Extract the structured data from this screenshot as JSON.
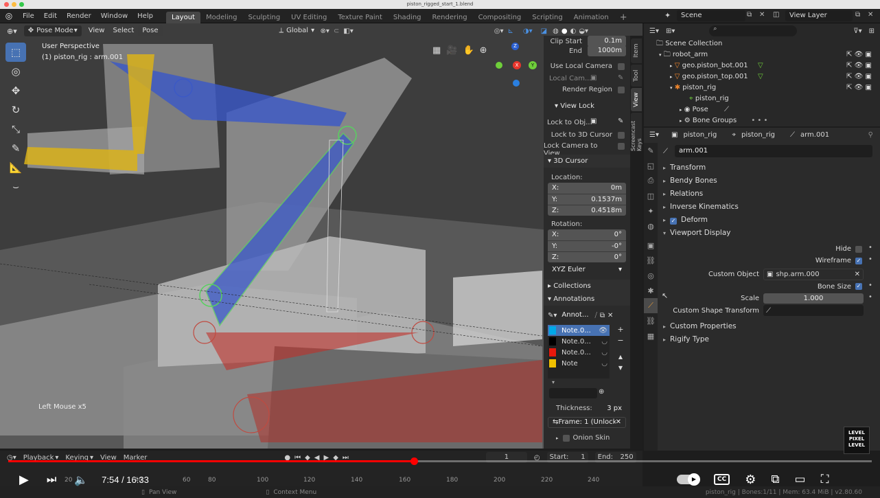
{
  "window": {
    "title": "piston_rigged_start_1.blend"
  },
  "topbar": {
    "menus": [
      "File",
      "Edit",
      "Render",
      "Window",
      "Help"
    ],
    "workspaces": [
      "Layout",
      "Modeling",
      "Sculpting",
      "UV Editing",
      "Texture Paint",
      "Shading",
      "Rendering",
      "Compositing",
      "Scripting",
      "Animation"
    ],
    "active_workspace": "Layout",
    "add_tab": "+",
    "scene": "Scene",
    "view_layer": "View Layer"
  },
  "viewport_header": {
    "mode": "Pose Mode",
    "view": "View",
    "select": "Select",
    "pose": "Pose",
    "orientation": "Global"
  },
  "viewport": {
    "perspective": "User Perspective",
    "object_info": "(1) piston_rig : arm.001",
    "last_op": "Left Mouse x5",
    "gizmo": {
      "z": "Z",
      "x": "X",
      "y": "Y"
    }
  },
  "npanel": {
    "clip_start_label": "Clip Start",
    "clip_start": "0.1m",
    "end_label": "End",
    "end": "1000m",
    "use_local_camera": "Use Local Camera",
    "local_camera": "Local Cam...",
    "render_region": "Render Region",
    "view_lock": "View Lock",
    "lock_to_obj": "Lock to Obj...",
    "lock_3d_cursor": "Lock to 3D Cursor",
    "lock_camera_to_view": "Lock Camera to View",
    "cursor_3d": "3D Cursor",
    "location": "Location:",
    "loc_x": "0m",
    "loc_y": "0.1537m",
    "loc_z": "0.4518m",
    "rotation": "Rotation:",
    "rot_x": "0°",
    "rot_y": "-0°",
    "rot_z": "0°",
    "rotation_mode": "XYZ Euler",
    "collections": "Collections",
    "annotations": "Annotations",
    "annot_name": "Annot...",
    "notes": [
      {
        "name": "Note.0...",
        "color": "#00a8e8"
      },
      {
        "name": "Note.0...",
        "color": "#000000"
      },
      {
        "name": "Note.0...",
        "color": "#e8180c"
      },
      {
        "name": "Note",
        "color": "#f0c000"
      }
    ],
    "thickness_label": "Thickness:",
    "thickness": "3 px",
    "frame_lock": "Frame: 1 (Unlocke...",
    "onion_skin": "Onion Skin",
    "tabs": [
      "Item",
      "Tool",
      "View",
      "Screencast Keys"
    ],
    "active_tab": "View"
  },
  "outliner": {
    "search_placeholder": "",
    "items": [
      {
        "label": "Scene Collection"
      },
      {
        "label": "robot_arm"
      },
      {
        "label": "geo.piston_bot.001"
      },
      {
        "label": "geo.piston_top.001"
      },
      {
        "label": "piston_rig"
      },
      {
        "label": "piston_rig"
      },
      {
        "label": "Pose"
      },
      {
        "label": "Bone Groups"
      }
    ]
  },
  "properties": {
    "breadcrumb": [
      "piston_rig",
      "piston_rig",
      "arm.001"
    ],
    "bone_name": "arm.001",
    "panels": [
      "Transform",
      "Bendy Bones",
      "Relations",
      "Inverse Kinematics",
      "Deform",
      "Viewport Display",
      "Custom Properties",
      "Rigify Type"
    ],
    "hide_label": "Hide",
    "wireframe_label": "Wireframe",
    "custom_object_label": "Custom Object",
    "custom_object": "shp.arm.000",
    "bone_size_label": "Bone Size",
    "scale_label": "Scale",
    "scale": "1.000",
    "custom_shape_transform_label": "Custom Shape Transform"
  },
  "timeline": {
    "playback": "Playback",
    "keying": "Keying",
    "view": "View",
    "marker": "Marker",
    "frame": "1",
    "start_label": "Start:",
    "start": "1",
    "end_label": "End:",
    "end": "250",
    "ticks": [
      "20",
      "40",
      "60",
      "80",
      "100",
      "120",
      "140",
      "160",
      "180",
      "200",
      "220",
      "240"
    ]
  },
  "video": {
    "time": "7:54 / 16:33",
    "progress": 0.47,
    "cc": "CC"
  },
  "statusbar": {
    "pan": "Pan View",
    "context": "Context Menu",
    "stats": "piston_rig | Bones:1/11 | Mem: 63.4 MiB | v2.80.60"
  },
  "logo": {
    "line1": "LEVEL",
    "line2": "PIXEL",
    "line3": "LEVEL"
  }
}
